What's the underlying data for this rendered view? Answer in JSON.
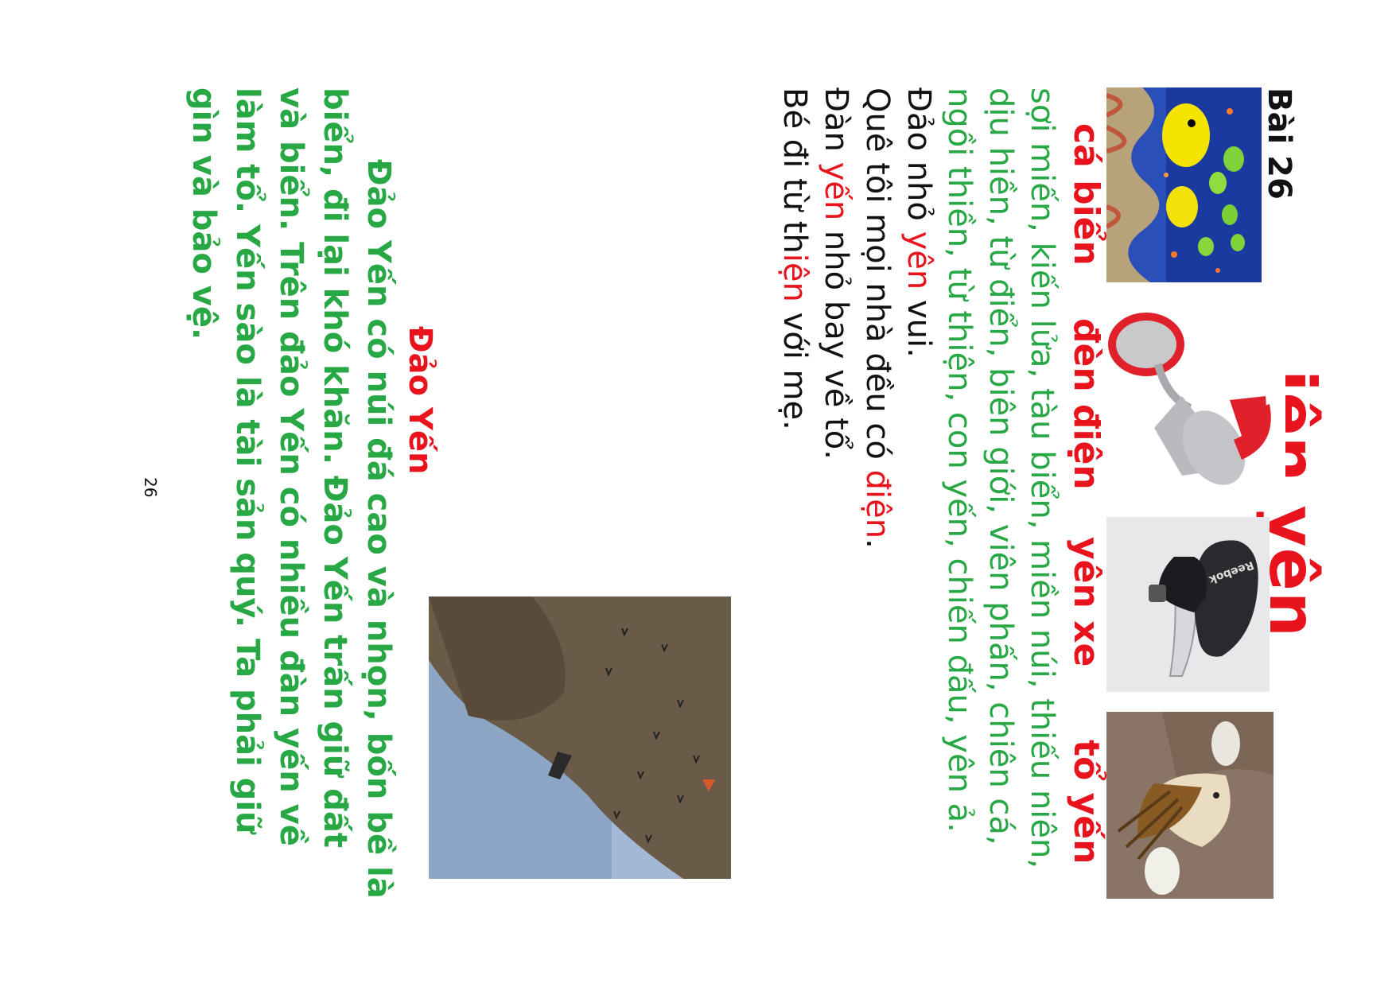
{
  "lesson": {
    "title": "Bài 26"
  },
  "rhyme_title": "iên  yên",
  "pictures": [
    {
      "caption": "cá biển",
      "icon": "tropical-fish-photo"
    },
    {
      "caption": "đèn điện",
      "icon": "desk-lamp-photo"
    },
    {
      "caption": "yên xe",
      "icon": "bicycle-saddle-photo",
      "brand_mark": "Reebok"
    },
    {
      "caption": "tổ yến",
      "icon": "swiftlet-nest-photo"
    }
  ],
  "vocabulary": "sợi miến, kiến lửa, tàu biển, miền núi, thiếu niên, dịu hiền, từ điển, biên giới, viên phấn, chiên cá, ngồi thiền, từ thiện, con yến, chiến đấu, yên ả.",
  "poem": {
    "lines": [
      {
        "before": "Đảo nhỏ ",
        "red": "yên",
        "after": " vui."
      },
      {
        "before": "Quê tôi mọi nhà đều có ",
        "red": "điện",
        "after": "."
      },
      {
        "before": "Đàn ",
        "red": "yến",
        "after": " nhỏ bay về tổ."
      },
      {
        "before": "Bé đi từ th",
        "red": "iện",
        "after": " với mẹ."
      }
    ]
  },
  "story": {
    "title": "Đảo Yến",
    "text": "Đảo Yến có núi đá cao và nhọn, bốn bề là biển, đi lại khó khăn. Đảo Yến trấn giữ đất và biển. Trên đảo Yến có nhiều đàn yến về làm tổ. Yến sào là tài sản quý. Ta phải giữ gìn và bảo vệ."
  },
  "island_photo": {
    "icon": "swiftlet-island-photo"
  },
  "page_number": "26",
  "colors": {
    "red": "#e8131c",
    "green": "#27a844",
    "black": "#111111"
  }
}
